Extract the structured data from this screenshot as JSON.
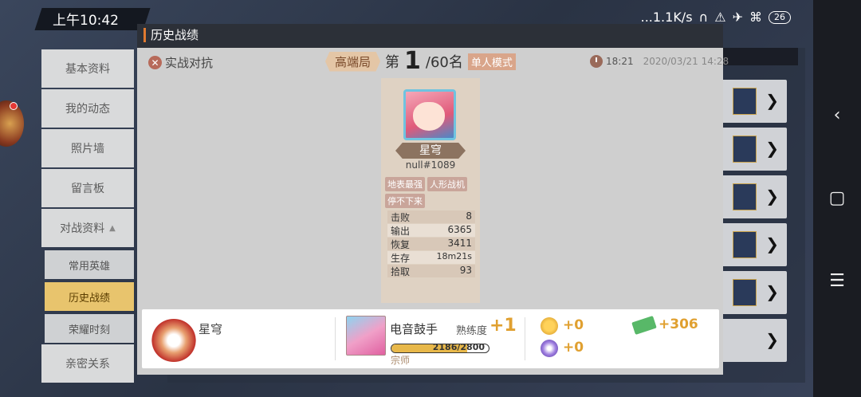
{
  "status_bar": {
    "time": "上午10:42",
    "network_speed": "...1.1K/s",
    "battery": "26"
  },
  "left_menu": {
    "items": [
      "基本资料",
      "我的动态",
      "照片墙",
      "留言板",
      "对战资料"
    ],
    "sub_items": [
      "常用英雄",
      "历史战绩",
      "荣耀时刻"
    ],
    "active_sub": "历史战绩",
    "last_item": "亲密关系"
  },
  "modal": {
    "title": "历史战绩",
    "battle_type": "实战对抗",
    "tier": "高端局",
    "rank_prefix": "第",
    "rank_value": "1",
    "rank_suffix": "/60名",
    "mode": "单人模式",
    "duration": "18:21",
    "datetime": "2020/03/21 14:28"
  },
  "player_card": {
    "hero_name": "星穹",
    "player_id": "null#1089",
    "tags": [
      "地表最强",
      "人形战机",
      "停不下来"
    ],
    "stats": [
      {
        "label": "击败",
        "value": "8"
      },
      {
        "label": "输出",
        "value": "6365"
      },
      {
        "label": "恢复",
        "value": "3411"
      },
      {
        "label": "生存",
        "value": "18m21s"
      },
      {
        "label": "拾取",
        "value": "93"
      }
    ]
  },
  "result": {
    "player_name": "星穹",
    "skin_name": "电音鼓手",
    "mastery_label": "熟练度",
    "mastery_gain": "+1",
    "mastery_progress": "2186/2800",
    "mastery_fraction": 0.78,
    "mastery_rank": "宗师",
    "coin_gain": "+0",
    "gem_gain": "+0",
    "money_gain": "+306"
  }
}
